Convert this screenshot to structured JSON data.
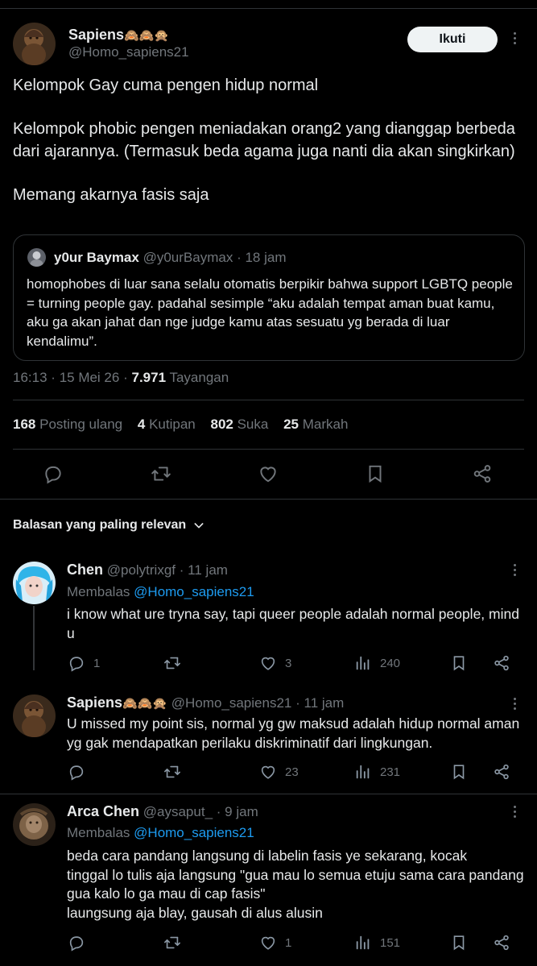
{
  "tweet": {
    "author_name": "Sapiens",
    "author_emoji": "🙈🙈🙊",
    "author_handle": "@Homo_sapiens21",
    "follow_label": "Ikuti",
    "paragraphs": [
      "Kelompok Gay cuma pengen hidup normal",
      "Kelompok phobic pengen meniadakan orang2 yang dianggap berbeda dari ajarannya. (Termasuk beda agama juga nanti dia akan singkirkan)",
      "Memang akarnya fasis saja"
    ],
    "time": "16:13",
    "date": "15 Mei 26",
    "views": "7.971",
    "views_label": "Tayangan",
    "stats": {
      "reposts": "168",
      "reposts_label": "Posting ulang",
      "quotes": "4",
      "quotes_label": "Kutipan",
      "likes": "802",
      "likes_label": "Suka",
      "bookmarks": "25",
      "bookmarks_label": "Markah"
    }
  },
  "quote": {
    "name": "y0ur Baymax",
    "handle": "@y0urBaymax",
    "time": "18 jam",
    "text": "homophobes di luar sana selalu otomatis berpikir bahwa support LGBTQ people = turning people gay. padahal sesimple “aku adalah tempat aman buat kamu, aku ga akan jahat dan nge judge kamu atas sesuatu yg berada di luar kendalimu”."
  },
  "sort_label": "Balasan yang paling relevan",
  "replying_prefix": "Membalas",
  "replies": [
    {
      "name": "Chen",
      "name_emoji": "",
      "handle": "@polytrixgf",
      "time": "11 jam",
      "replying_to": "@Homo_sapiens21",
      "text": "i know what ure tryna say, tapi queer people adalah normal people, mind u",
      "replies": "1",
      "reposts": "",
      "likes": "3",
      "views": "240"
    },
    {
      "name": "Sapiens",
      "name_emoji": "🙈🙈🙊",
      "handle": "@Homo_sapiens21",
      "time": "11 jam",
      "replying_to": "",
      "text": "U missed my point sis, normal yg gw maksud adalah hidup normal aman yg gak mendapatkan perilaku diskriminatif dari lingkungan.",
      "replies": "",
      "reposts": "",
      "likes": "23",
      "views": "231"
    },
    {
      "name": "Arca Chen",
      "name_emoji": "",
      "handle": "@aysaput_",
      "time": "9 jam",
      "replying_to": "@Homo_sapiens21",
      "text_lines": [
        "beda cara pandang langsung di labelin fasis ye sekarang, kocak",
        "tinggal lo tulis aja langsung \"gua mau lo semua etuju sama cara pandang gua kalo lo ga mau di cap fasis\"",
        "laungsung aja blay, gausah di alus alusin"
      ],
      "replies": "",
      "reposts": "",
      "likes": "1",
      "views": "151"
    }
  ],
  "separator": "·",
  "icons": [
    "reply-icon",
    "repost-icon",
    "like-icon",
    "bookmark-icon",
    "share-icon",
    "views-icon",
    "more-icon",
    "chevron-down-icon"
  ]
}
